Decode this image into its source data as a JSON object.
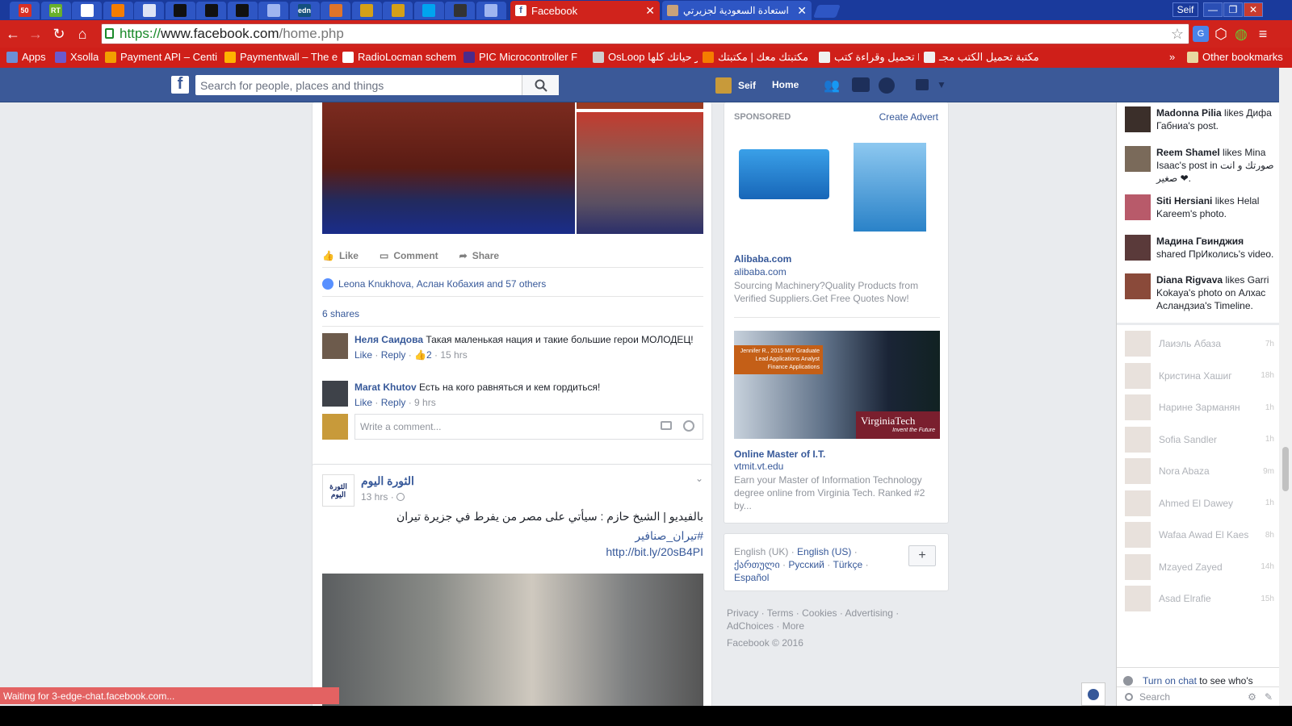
{
  "browser": {
    "pinned_tabs": [
      {
        "icon": "badge-50-icon",
        "label": "50",
        "color": "#d93025"
      },
      {
        "icon": "rt-icon",
        "label": "RT",
        "color": "#69b02a"
      },
      {
        "icon": "flag-russia-icon",
        "label": "",
        "color": "#ffffff"
      },
      {
        "icon": "blogger-icon",
        "label": "",
        "color": "#f57d00"
      },
      {
        "icon": "moon-icon",
        "label": "",
        "color": "#dde3f5"
      },
      {
        "icon": "github-icon",
        "label": "",
        "color": "#111111"
      },
      {
        "icon": "github-icon",
        "label": "",
        "color": "#111111"
      },
      {
        "icon": "github-icon",
        "label": "",
        "color": "#111111"
      },
      {
        "icon": "page-icon",
        "label": "",
        "color": "#9fb5f0"
      },
      {
        "icon": "edn-icon",
        "label": "edn",
        "color": "#14507d"
      },
      {
        "icon": "stack-icon",
        "label": "",
        "color": "#e0742a"
      },
      {
        "icon": "bookmark-icon",
        "label": "",
        "color": "#d4a017"
      },
      {
        "icon": "bookmark-icon",
        "label": "",
        "color": "#d4a017"
      },
      {
        "icon": "windows-icon",
        "label": "",
        "color": "#00a4ef"
      },
      {
        "icon": "book-icon",
        "label": "",
        "color": "#333333"
      },
      {
        "icon": "page-icon",
        "label": "",
        "color": "#9fb5f0"
      }
    ],
    "active_tab": {
      "title": "Facebook",
      "icon": "facebook-icon"
    },
    "other_tab": {
      "title": "استعادة السعودية لجزيرتي"
    },
    "profile_button": "Seif",
    "url": {
      "scheme": "https://",
      "host": "www.facebook.com",
      "path": "/home.php"
    },
    "bookmarks": [
      {
        "label": "Apps",
        "icon": "apps-icon"
      },
      {
        "label": "Xsolla",
        "icon": "xsolla-icon"
      },
      {
        "label": "Payment API – Centi",
        "icon": "payment-icon"
      },
      {
        "label": "Paymentwall – The e",
        "icon": "paymentwall-icon"
      },
      {
        "label": "RadioLocman schem",
        "icon": "rl-icon"
      },
      {
        "label": "PIC Microcontroller F",
        "icon": "pic-icon"
      },
      {
        "label": "OsLoop خير حياتك كلها",
        "icon": "osloop-icon"
      },
      {
        "label": "مكتبتك معك | مكتبتك",
        "icon": "blogger-icon"
      },
      {
        "label": "تحميل وقراءة كتب PDF",
        "icon": "doc-icon"
      },
      {
        "label": "مكتبة تحميل الكتب مجـ",
        "icon": "doc-icon"
      }
    ],
    "bookmarks_more": "»",
    "other_bookmarks": "Other bookmarks",
    "status_text": "Waiting for 3-edge-chat.facebook.com..."
  },
  "fb": {
    "search_placeholder": "Search for people, places and things",
    "user_name": "Seif",
    "home_label": "Home",
    "post1": {
      "actions": {
        "like": "Like",
        "comment": "Comment",
        "share": "Share"
      },
      "likes_text": "Leona Knukhova, Аслан Кобахия and 57 others",
      "shares_text": "6 shares",
      "comments": [
        {
          "author": "Неля Саидова",
          "text": "Такая маленькая нация и такие большие герои МОЛОДЕЦ!",
          "like": "Like",
          "reply": "Reply",
          "likes": "2",
          "time": "15 hrs"
        },
        {
          "author": "Marat Khutov",
          "text": "Есть на кого равняться и кем гордиться!",
          "like": "Like",
          "reply": "Reply",
          "time": "9 hrs"
        }
      ],
      "comment_placeholder": "Write a comment..."
    },
    "post2": {
      "page_name": "الثورة اليوم",
      "avatar_text": "الثورة اليوم",
      "time": "13 hrs",
      "text": "بالفيديو | الشيخ حازم : سيأتي على مصر من يفرط في جزيرة تيران",
      "hashtag": "#تيران_صنافير",
      "link": "http://bit.ly/20sB4PI"
    },
    "ads": {
      "sponsored": "SPONSORED",
      "create_advert": "Create Advert",
      "ad1": {
        "title": "Alibaba.com",
        "domain": "alibaba.com",
        "desc": "Sourcing Machinery?Quality Products from Verified Suppliers.Get Free Quotes Now!"
      },
      "ad2": {
        "title": "Online Master of I.T.",
        "domain": "vtmit.vt.edu",
        "desc": "Earn your Master of Information Technology degree online from Virginia Tech. Ranked #2 by...",
        "banner_line1": "Jennifer R., 2015 MIT Graduate",
        "banner_line2": "Lead Applications Analyst",
        "banner_line3": "Finance Applications",
        "brand": "VirginiaTech",
        "tagline": "Invent the Future"
      }
    },
    "languages": {
      "current": "English (UK)",
      "items": [
        "English (US)",
        "ქართული",
        "Русский",
        "Türkçe",
        "Español"
      ],
      "add": "+"
    },
    "footer": {
      "links": [
        "Privacy",
        "Terms",
        "Cookies",
        "Advertising",
        "AdChoices",
        "More"
      ],
      "copyright": "Facebook © 2016"
    },
    "ticker": [
      {
        "name": "Madonna Pilia",
        "text": "likes Дифа Габниа's post."
      },
      {
        "name": "Reem Shamel",
        "text": "likes Mina Isaac's post in صورتك و انت صغير ❤."
      },
      {
        "name": "Siti Hersiani",
        "text": "likes Helal Kareem's photo."
      },
      {
        "name": "Мадина Гвинджия",
        "text": "shared ПрИколись's video."
      },
      {
        "name": "Diana Rigvava",
        "text": "likes Garri Kokaya's photo on Алхас Асландзиа's Timeline."
      }
    ],
    "chat": [
      {
        "name": "Лаиэль Абаза",
        "time": "7h"
      },
      {
        "name": "Кристина Хашиг",
        "time": "18h"
      },
      {
        "name": "Нарине Зарманян",
        "time": "1h"
      },
      {
        "name": "Sofia Sandler",
        "time": "1h"
      },
      {
        "name": "Nora Abaza",
        "time": "9m"
      },
      {
        "name": "Ahmed El Dawey",
        "time": "1h"
      },
      {
        "name": "Wafaa Awad El Kaes",
        "time": "8h"
      },
      {
        "name": "Mzayed Zayed",
        "time": "14h"
      },
      {
        "name": "Asad Elrafie",
        "time": "15h"
      }
    ],
    "chat_turn_on_link": "Turn on chat",
    "chat_turn_on_rest": "to see who's available.",
    "chat_search": "Search"
  }
}
